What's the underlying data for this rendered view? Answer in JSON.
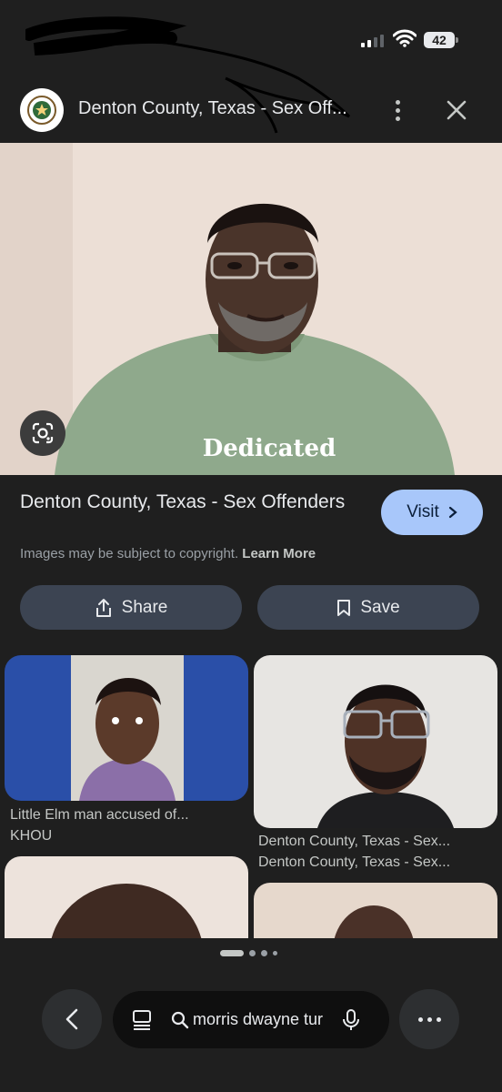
{
  "status_bar": {
    "battery": "42"
  },
  "header": {
    "site_title": "Denton County, Texas - Sex Off...",
    "more_icon": "more-vertical-icon",
    "close_icon": "close-icon"
  },
  "hero": {
    "shirt_text": "Dedicated",
    "lens_icon": "google-lens-icon"
  },
  "result": {
    "title": "Denton County, Texas - Sex Offenders",
    "visit_label": "Visit",
    "copyright_text": "Images may be subject to copyright.",
    "learn_more": "Learn More",
    "share_label": "Share",
    "save_label": "Save"
  },
  "related": [
    {
      "caption": "Little Elm man accused of...",
      "source": "KHOU"
    },
    {
      "caption": "Denton County, Texas - Sex...",
      "source": "Denton County, Texas - Sex..."
    }
  ],
  "bottom_bar": {
    "query": "morris dwayne tur",
    "back_icon": "back-icon",
    "tabs_icon": "tabs-icon",
    "search_icon": "search-icon",
    "mic_icon": "microphone-icon",
    "more_icon": "more-horizontal-icon"
  },
  "colors": {
    "background": "#1f1f1f",
    "visit_button": "#a8c7fa",
    "pill_button": "#3c4452"
  }
}
